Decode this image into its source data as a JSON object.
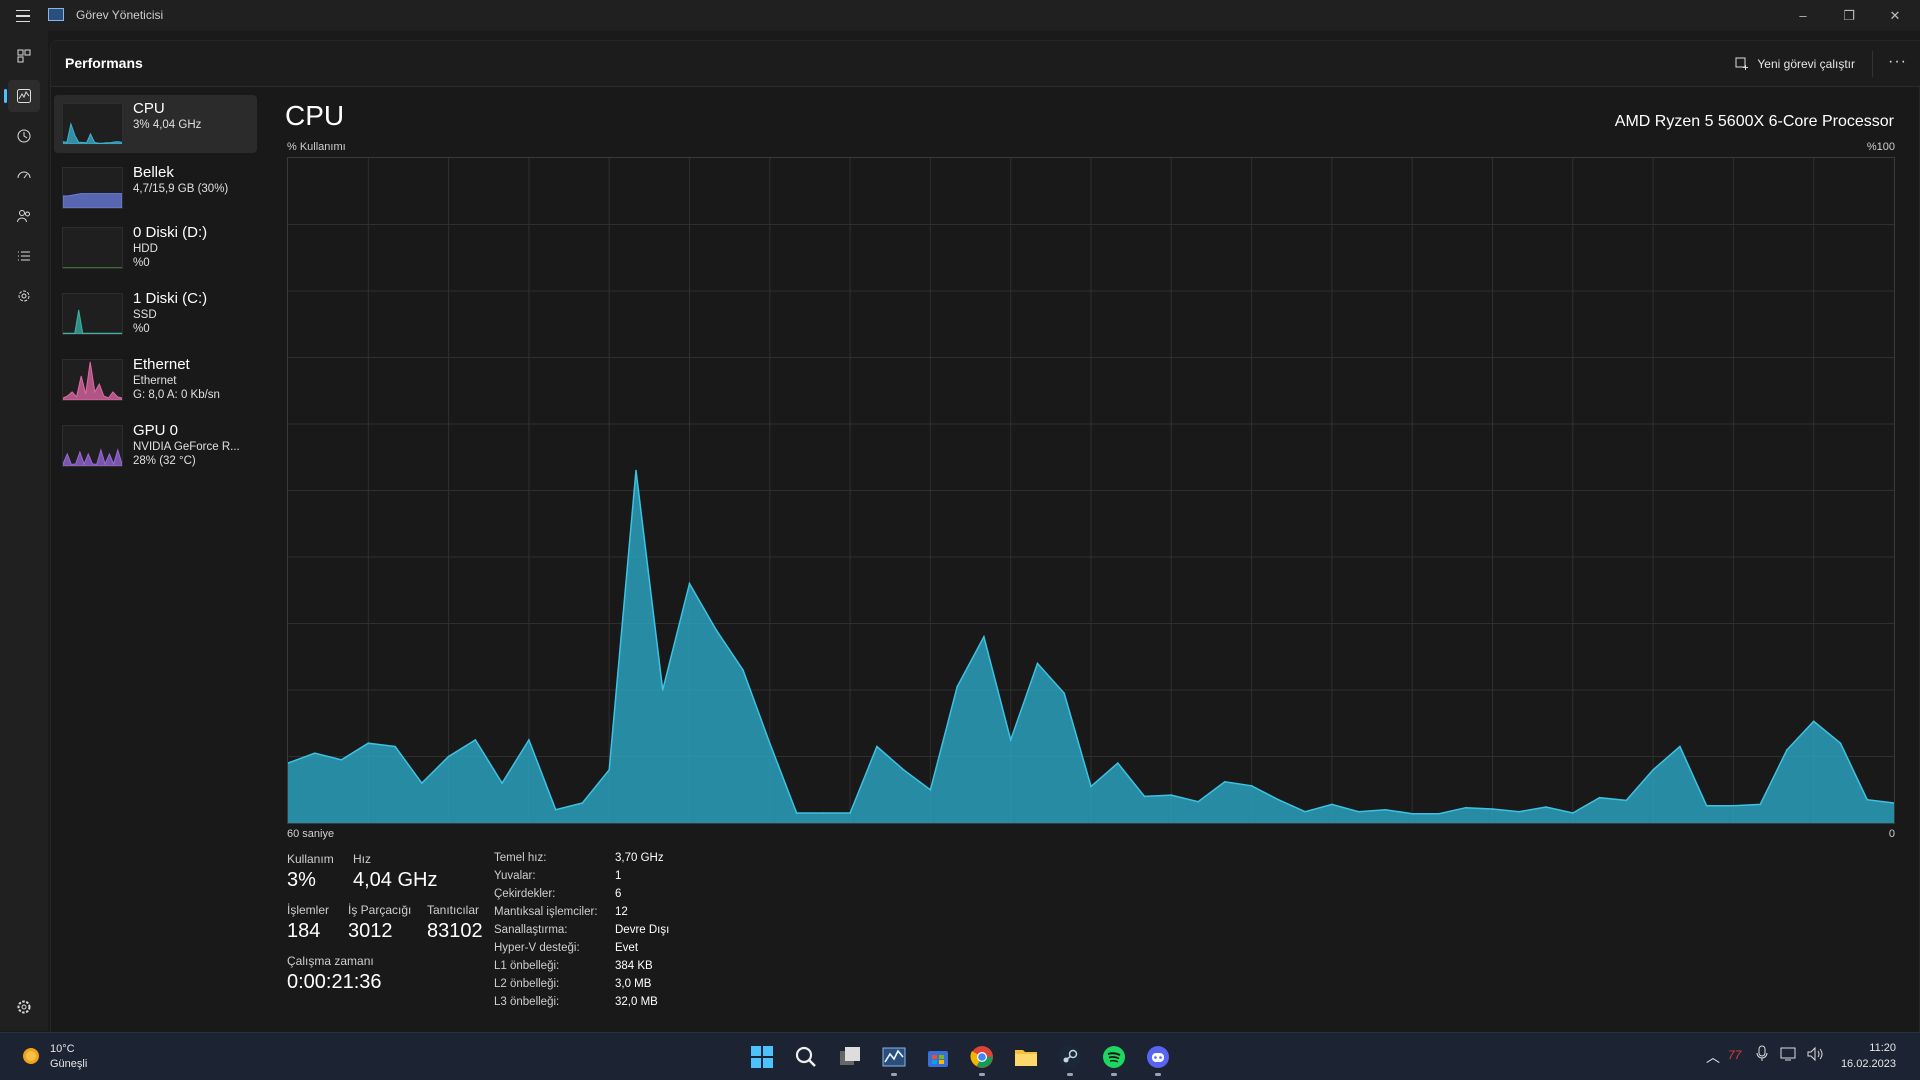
{
  "window": {
    "title": "Görev Yöneticisi",
    "controls": [
      "–",
      "❐",
      "✕"
    ]
  },
  "rail": {
    "icons": [
      "processes-icon",
      "performance-icon",
      "app-history-icon",
      "startup-icon",
      "users-icon",
      "details-icon",
      "services-icon",
      "settings-icon"
    ],
    "active": "performance-icon"
  },
  "header": {
    "page_title": "Performans",
    "run_task_label": "Yeni görevi çalıştır",
    "more_label": "···"
  },
  "devices": [
    {
      "name": "CPU",
      "line2": "3% 4,04 GHz",
      "line3": "",
      "color": "#3bb3d0"
    },
    {
      "name": "Bellek",
      "line2": "4,7/15,9 GB (30%)",
      "line3": "",
      "color": "#6b7fe0"
    },
    {
      "name": "0 Diski (D:)",
      "line2": "HDD",
      "line3": "%0",
      "color": "#5fbf52"
    },
    {
      "name": "1 Diski (C:)",
      "line2": "SSD",
      "line3": "%0",
      "color": "#3bb3a8"
    },
    {
      "name": "Ethernet",
      "line2": "Ethernet",
      "line3": "G: 8,0 A: 0 Kb/sn",
      "color": "#e06aa8"
    },
    {
      "name": "GPU 0",
      "line2": "NVIDIA GeForce R...",
      "line3": "28% (32 °C)",
      "color": "#9a6ad8"
    }
  ],
  "main": {
    "title": "CPU",
    "model": "AMD Ryzen 5 5600X 6-Core Processor",
    "usage_axis_label": "% Kullanımı",
    "max_label": "%100",
    "time_label": "60 saniye",
    "min_label": "0"
  },
  "chart_data": {
    "type": "area",
    "title": "CPU",
    "ylabel": "% Kullanımı",
    "xlabel": "60 saniye",
    "ylim": [
      0,
      100
    ],
    "xlim": [
      0,
      60
    ],
    "grid": true,
    "color": "#2aa0bd",
    "x": [
      0,
      1,
      2,
      3,
      4,
      5,
      6,
      7,
      8,
      9,
      10,
      11,
      12,
      13,
      14,
      15,
      16,
      17,
      18,
      19,
      20,
      21,
      22,
      23,
      24,
      25,
      26,
      27,
      28,
      29,
      30,
      31,
      32,
      33,
      34,
      35,
      36,
      37,
      38,
      39,
      40,
      41,
      42,
      43,
      44,
      45,
      46,
      47,
      48,
      49,
      50,
      51,
      52,
      53,
      54,
      55,
      56,
      57,
      58,
      59,
      60
    ],
    "values": [
      9,
      10.5,
      9.5,
      12,
      11.5,
      6,
      10,
      12.5,
      6,
      12.5,
      2,
      3,
      8,
      53,
      20,
      36,
      29,
      23,
      12,
      1.5,
      1.5,
      1.5,
      11.5,
      8,
      5,
      20.5,
      28,
      12.5,
      24,
      19.5,
      5.5,
      9,
      4,
      4.2,
      3.2,
      6.2,
      5.6,
      3.5,
      1.7,
      2.8,
      1.7,
      2,
      1.4,
      1.4,
      2.3,
      2.1,
      1.7,
      2.4,
      1.5,
      3.8,
      3.4,
      8,
      11.5,
      2.6,
      2.6,
      2.8,
      11,
      15.3,
      12,
      3.5,
      3
    ]
  },
  "stats": {
    "usage_label": "Kullanım",
    "usage_value": "3%",
    "speed_label": "Hız",
    "speed_value": "4,04 GHz",
    "processes_label": "İşlemler",
    "processes_value": "184",
    "threads_label": "İş Parçacığı",
    "threads_value": "3012",
    "handles_label": "Tanıtıcılar",
    "handles_value": "83102",
    "uptime_label": "Çalışma zamanı",
    "uptime_value": "0:00:21:36"
  },
  "specs": [
    {
      "k": "Temel hız:",
      "v": "3,70 GHz"
    },
    {
      "k": "Yuvalar:",
      "v": "1"
    },
    {
      "k": "Çekirdekler:",
      "v": "6"
    },
    {
      "k": "Mantıksal işlemciler:",
      "v": "12"
    },
    {
      "k": "Sanallaştırma:",
      "v": "Devre Dışı"
    },
    {
      "k": "Hyper-V desteği:",
      "v": "Evet"
    },
    {
      "k": "L1 önbelleği:",
      "v": "384 KB"
    },
    {
      "k": "L2 önbelleği:",
      "v": "3,0 MB"
    },
    {
      "k": "L3 önbelleği:",
      "v": "32,0 MB"
    }
  ],
  "taskbar": {
    "weather_temp": "10°C",
    "weather_desc": "Güneşli",
    "apps": [
      "start-icon",
      "search-icon",
      "task-view-icon",
      "task-manager-icon",
      "store-icon",
      "chrome-icon",
      "file-explorer-icon",
      "steam-icon",
      "spotify-icon",
      "discord-icon"
    ],
    "tray_temp": "77",
    "time": "11:20",
    "date": "16.02.2023"
  }
}
